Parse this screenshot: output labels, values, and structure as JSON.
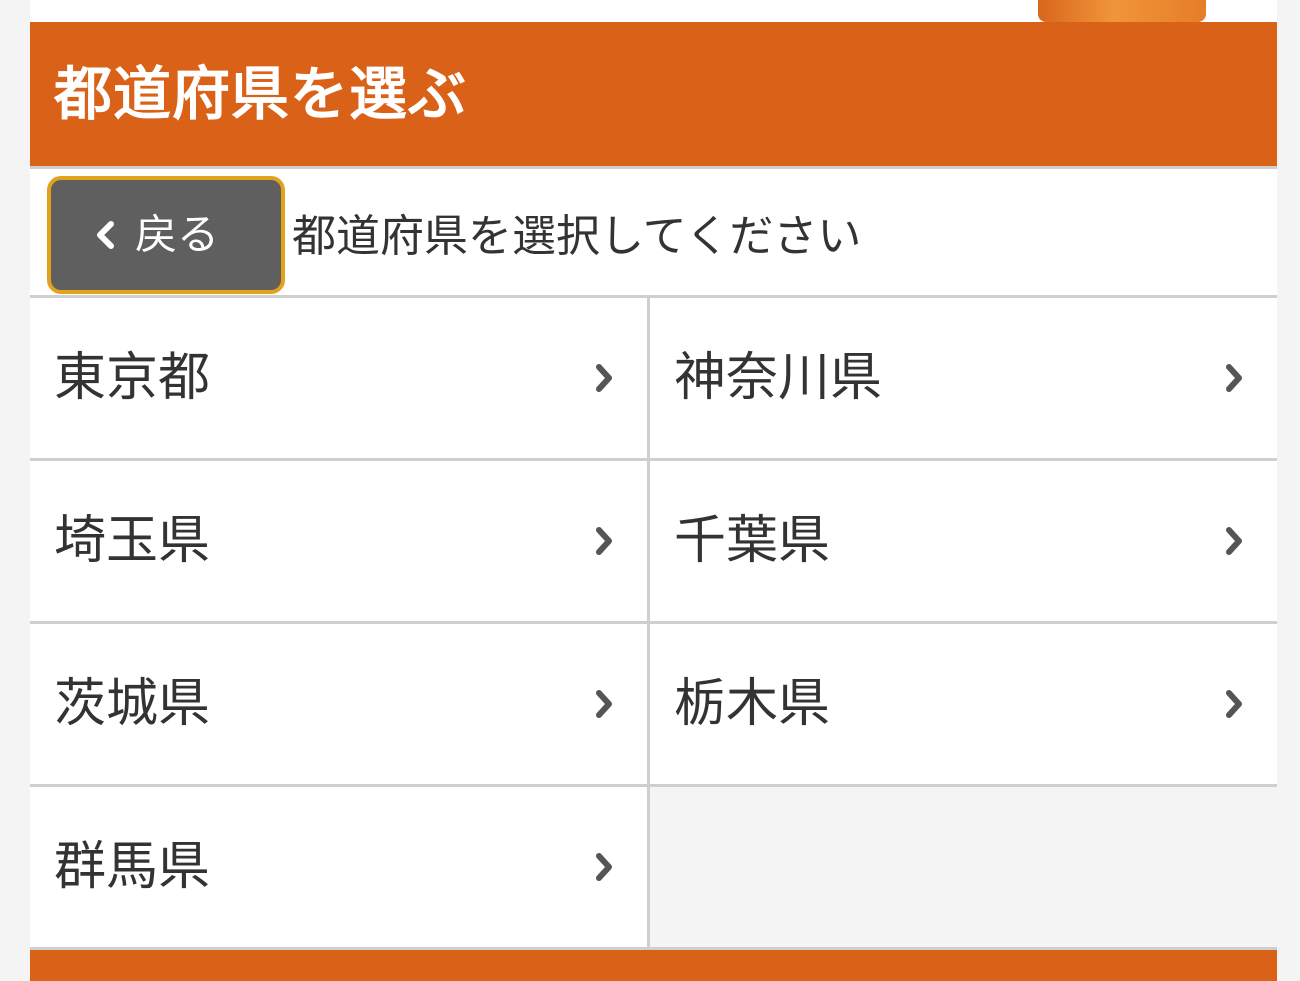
{
  "header": {
    "title": "都道府県を選ぶ"
  },
  "subbar": {
    "back_label": "戻る",
    "instruction": "都道府県を選択してください"
  },
  "prefectures": [
    {
      "label": "東京都"
    },
    {
      "label": "神奈川県"
    },
    {
      "label": "埼玉県"
    },
    {
      "label": "千葉県"
    },
    {
      "label": "茨城県"
    },
    {
      "label": "栃木県"
    },
    {
      "label": "群馬県"
    }
  ],
  "icons": {
    "back": "chevron-left-icon",
    "item": "chevron-right-icon"
  },
  "colors": {
    "header_bg": "#da6118",
    "back_button_bg": "#5f5f5f",
    "back_button_border": "#e3a21c"
  }
}
